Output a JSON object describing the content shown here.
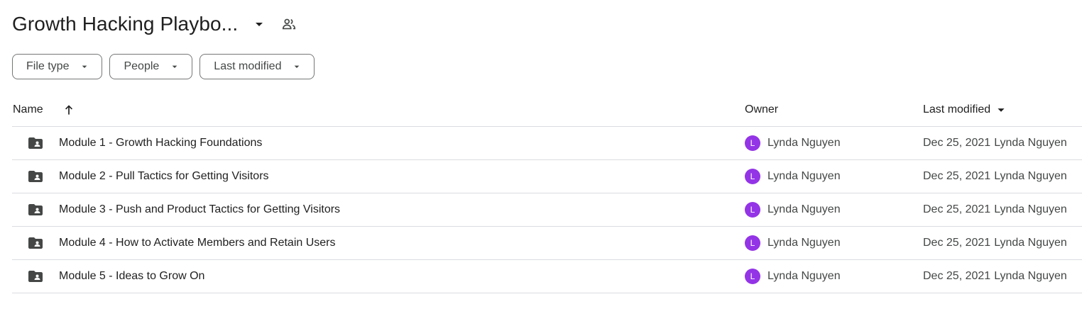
{
  "header": {
    "title": "Growth Hacking Playbo...",
    "title_caret_icon": "arrow-drop-down-icon",
    "shared_icon": "people-icon"
  },
  "filters": [
    {
      "label": "File type"
    },
    {
      "label": "People"
    },
    {
      "label": "Last modified"
    }
  ],
  "table": {
    "columns": {
      "name": "Name",
      "owner": "Owner",
      "last_modified": "Last modified"
    },
    "name_sort_icon": "arrow-upward-icon",
    "rows": [
      {
        "name": "Module 1 - Growth Hacking Foundations",
        "owner": "Lynda Nguyen",
        "owner_initial": "L",
        "modified_date": "Dec 25, 2021",
        "modified_by": "Lynda Nguyen"
      },
      {
        "name": "Module 2 - Pull Tactics for Getting Visitors",
        "owner": "Lynda Nguyen",
        "owner_initial": "L",
        "modified_date": "Dec 25, 2021",
        "modified_by": "Lynda Nguyen"
      },
      {
        "name": "Module 3 - Push and Product Tactics for Getting Visitors",
        "owner": "Lynda Nguyen",
        "owner_initial": "L",
        "modified_date": "Dec 25, 2021",
        "modified_by": "Lynda Nguyen"
      },
      {
        "name": "Module 4 - How to Activate Members and Retain Users",
        "owner": "Lynda Nguyen",
        "owner_initial": "L",
        "modified_date": "Dec 25, 2021",
        "modified_by": "Lynda Nguyen"
      },
      {
        "name": "Module 5 - Ideas to Grow On",
        "owner": "Lynda Nguyen",
        "owner_initial": "L",
        "modified_date": "Dec 25, 2021",
        "modified_by": "Lynda Nguyen"
      }
    ]
  },
  "colors": {
    "avatar": "#9334e6",
    "folder_icon": "#444746",
    "divider": "#dadce0"
  }
}
